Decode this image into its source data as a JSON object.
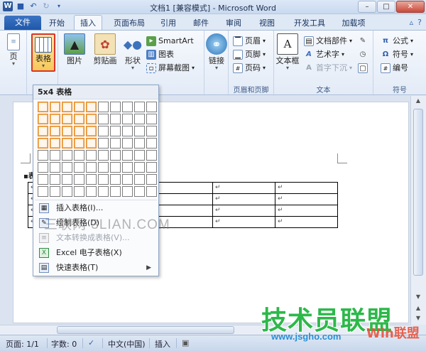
{
  "window": {
    "title": "文档1 [兼容模式] - Microsoft Word",
    "minimize": "–",
    "maximize": "□",
    "close": "✕"
  },
  "qat": {
    "word_logo": "W"
  },
  "tabs": {
    "file": "文件",
    "items": [
      "开始",
      "插入",
      "页面布局",
      "引用",
      "邮件",
      "审阅",
      "视图",
      "开发工具",
      "加载项"
    ],
    "active": "插入"
  },
  "ribbon": {
    "pages": {
      "label": "页"
    },
    "tables": {
      "label": "表格"
    },
    "illustrations": {
      "picture": "图片",
      "clipart": "剪贴画",
      "shapes": "形状",
      "smartart": "SmartArt",
      "chart": "图表",
      "screenshot": "屏幕截图"
    },
    "links": {
      "label": "链接"
    },
    "header_footer": {
      "header": "页眉",
      "footer": "页脚",
      "page_number": "页码",
      "group_label": "页眉和页脚"
    },
    "text": {
      "textbox": "文本框",
      "quickparts": "文档部件",
      "wordart": "艺术字",
      "dropcap": "首字下沉",
      "group_label": "文本"
    },
    "symbols": {
      "equation": "公式",
      "symbol": "符号",
      "numbering": "编号",
      "group_label": "符号"
    }
  },
  "table_menu": {
    "header": "5x4 表格",
    "grid_cols": 10,
    "grid_rows": 8,
    "selected_cols": 5,
    "selected_rows": 4,
    "items": [
      {
        "label": "插入表格(I)...",
        "disabled": false
      },
      {
        "label": "绘制表格(D)",
        "disabled": false
      },
      {
        "label": "文本转换成表格(V)...",
        "disabled": true
      },
      {
        "label": "Excel 电子表格(X)",
        "disabled": false
      },
      {
        "label": "快速表格(T)",
        "disabled": false,
        "submenu": true
      }
    ]
  },
  "document": {
    "para_mark": "↵",
    "text_fragment": "表"
  },
  "statusbar": {
    "page": "页面: 1/1",
    "words": "字数: 0",
    "language": "中文(中国)",
    "mode": "插入"
  },
  "watermarks": {
    "site1": "三联网 3LIAN.COM",
    "logo_main": "技术员联盟",
    "logo_url": "www.jsgho.com",
    "logo_side": "Win联盟"
  }
}
